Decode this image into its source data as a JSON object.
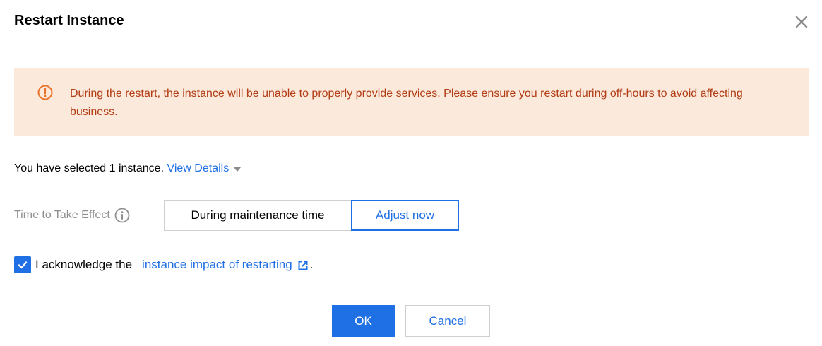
{
  "dialog": {
    "title": "Restart Instance",
    "close_icon": "close-icon"
  },
  "alert": {
    "icon": "warning-circle-icon",
    "text": "During the restart, the instance will be unable to properly provide services. Please ensure you restart during off-hours to avoid affecting business."
  },
  "selection": {
    "text": "You have selected 1 instance.",
    "view_details_label": "View Details"
  },
  "effect": {
    "label": "Time to Take Effect",
    "options": [
      "During maintenance time",
      "Adjust now"
    ],
    "selected": "Adjust now"
  },
  "acknowledge": {
    "checked": true,
    "text": "I acknowledge the",
    "link_label": "instance impact of restarting",
    "suffix": "."
  },
  "footer": {
    "ok_label": "OK",
    "cancel_label": "Cancel"
  },
  "colors": {
    "primary": "#1f6fe5",
    "alert_bg": "#fbe9db",
    "alert_text": "#b23c14",
    "alert_icon": "#e8732c"
  }
}
